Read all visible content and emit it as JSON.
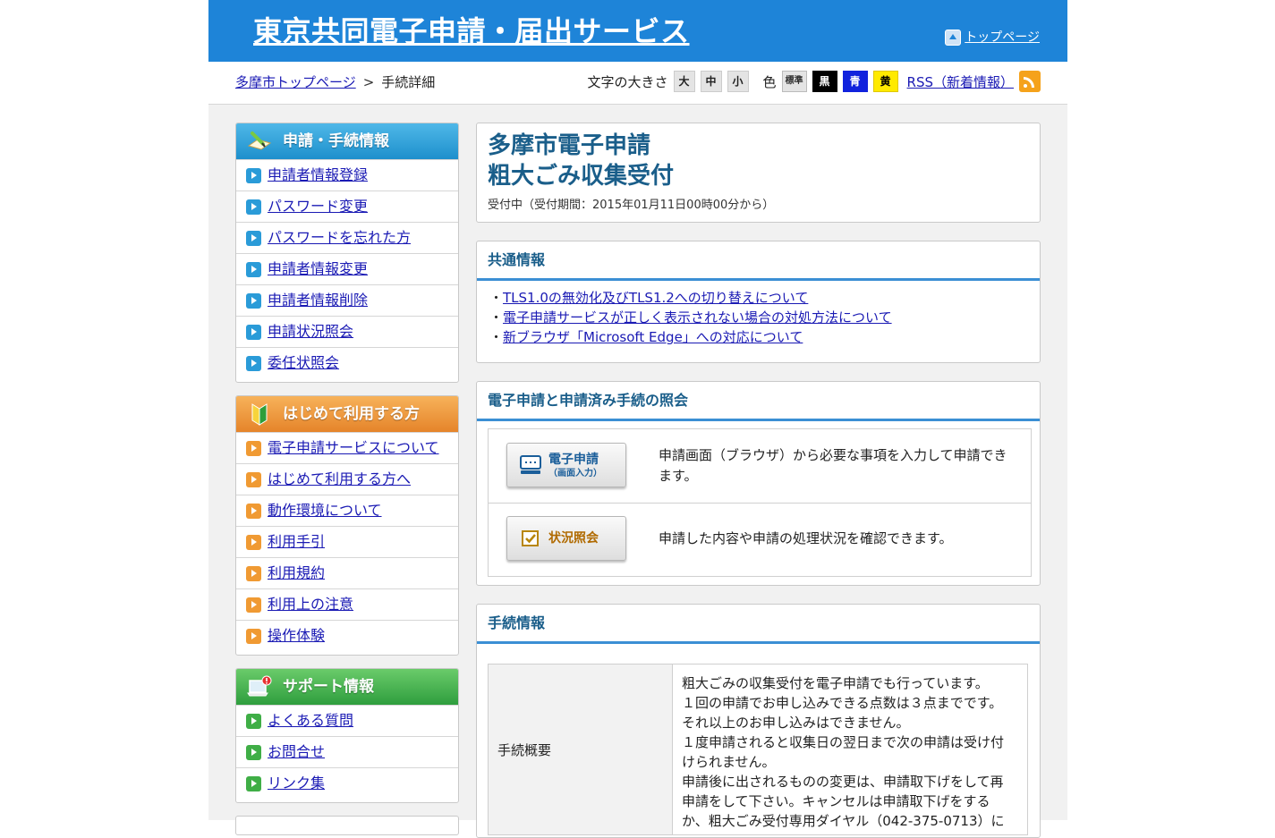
{
  "header": {
    "site_title": "東京共同電子申請・届出サービス",
    "top_link": "トップページ"
  },
  "breadcrumb": {
    "home": "多摩市トップページ",
    "separator": ">",
    "current": "手続詳細"
  },
  "tools": {
    "font_size_label": "文字の大きさ",
    "size_large": "大",
    "size_medium": "中",
    "size_small": "小",
    "color_label": "色",
    "color_standard": "標準",
    "color_black": "黒",
    "color_blue": "青",
    "color_yellow": "黄",
    "rss_link": "RSS（新着情報）"
  },
  "sidebar": {
    "application": {
      "heading": "申請・手続情報",
      "items": [
        {
          "label": "申請者情報登録"
        },
        {
          "label": "パスワード変更"
        },
        {
          "label": "パスワードを忘れた方"
        },
        {
          "label": "申請者情報変更"
        },
        {
          "label": "申請者情報削除"
        },
        {
          "label": "申請状況照会"
        },
        {
          "label": "委任状照会"
        }
      ]
    },
    "first_time": {
      "heading": "はじめて利用する方",
      "items": [
        {
          "label": "電子申請サービスについて"
        },
        {
          "label": "はじめて利用する方へ"
        },
        {
          "label": "動作環境について"
        },
        {
          "label": "利用手引"
        },
        {
          "label": "利用規約"
        },
        {
          "label": "利用上の注意"
        },
        {
          "label": "操作体験"
        }
      ]
    },
    "support": {
      "heading": "サポート情報",
      "items": [
        {
          "label": "よくある質問"
        },
        {
          "label": "お問合せ"
        },
        {
          "label": "リンク集"
        }
      ]
    }
  },
  "procedure": {
    "title_line1": "多摩市電子申請",
    "title_line2": "粗大ごみ収集受付",
    "status": "受付中（受付期間：2015年01月11日00時00分から）"
  },
  "common_info": {
    "heading": "共通情報",
    "links": [
      {
        "label": "TLS1.0の無効化及びTLS1.2への切り替えについて"
      },
      {
        "label": "電子申請サービスが正しく表示されない場合の対処方法について"
      },
      {
        "label": "新ブラウザ「Microsoft Edge」への対応について"
      }
    ]
  },
  "apply_section": {
    "heading": "電子申請と申請済み手続の照会",
    "apply_button": "電子申請",
    "apply_button_sub": "（画面入力）",
    "apply_desc": "申請画面（ブラウザ）から必要な事項を入力して申請できます。",
    "status_button": "状況照会",
    "status_desc": "申請した内容や申請の処理状況を確認できます。"
  },
  "procedure_info": {
    "heading": "手続情報",
    "rows": [
      {
        "label": "手続概要",
        "value_lines": [
          "粗大ごみの収集受付を電子申請でも行っています。",
          "１回の申請でお申し込みできる点数は３点までです。",
          "それ以上のお申し込みはできません。",
          "１度申請されると収集日の翌日まで次の申請は受け付",
          "けられません。",
          "申請後に出されるものの変更は、申請取下げをして再",
          "申請をして下さい。キャンセルは申請取下げをする",
          "か、粗大ごみ受付専用ダイヤル（042-375-0713）に"
        ]
      }
    ]
  },
  "colors": {
    "header_blue": "#1e84d8",
    "section_title": "#1a5e8a",
    "link": "#1a1ab4"
  }
}
